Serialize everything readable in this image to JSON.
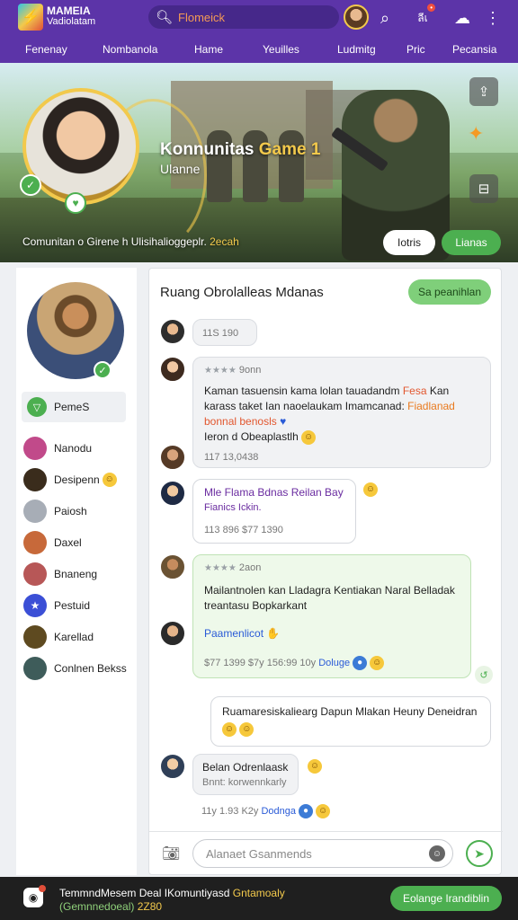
{
  "app": {
    "brand_line1": "MAMEIA",
    "brand_line2": "Vadiolatam",
    "search_text": "Flomeick",
    "notification_text": "ลีเ"
  },
  "nav": [
    "Fenenay",
    "Nombanola",
    "Hame",
    "Yeuilles",
    "Ludmitg",
    "Pric",
    "Pecansia"
  ],
  "hero": {
    "title_main": "Konnunitas",
    "title_highlight": "Game 1",
    "subtitle": "Ulanne",
    "desc_main": "Comunitan o Girene h Ulisihalioggeplr.",
    "desc_highlight": "2ecah",
    "btn_white": "Iotris",
    "btn_green": "Lianas"
  },
  "sidebar": {
    "active_label": "PemeS",
    "items": [
      {
        "label": "Nanodu",
        "color": "#c14a8a"
      },
      {
        "label": "Desipenn",
        "color": "#3a2c1c",
        "emoji": true
      },
      {
        "label": "Paiosh",
        "color": "#a7adb6"
      },
      {
        "label": "Daxel",
        "color": "#c7693a"
      },
      {
        "label": "Bnaneng",
        "color": "#b75757"
      },
      {
        "label": "Pestuid",
        "color": "#3b4fd6"
      },
      {
        "label": "Karellad",
        "color": "#5e4a20"
      },
      {
        "label": "Conlnen Bekss",
        "color": "#3e5c5a"
      }
    ]
  },
  "chat": {
    "title": "Ruang Obrolalleas Mdanas",
    "pill": "Sa peanihlan",
    "msg1": {
      "meta": "11S 190"
    },
    "msg2": {
      "stars": "★★★★",
      "head": "9onn",
      "line1a": "Kaman tasuensin kama lolan tauadandm",
      "line1b": "Fesa",
      "line1c": "Kan",
      "line2a": "karass taket Ian naoelaukam Imamcanad:",
      "line2b": "Fiadlanad",
      "line3": "bonnal benosls",
      "line4": "Ieron d Obeaplastlh",
      "meta": "117 13,0438"
    },
    "msg3": {
      "title": "Mle Flama Bdnas Reilan Bay",
      "sub": "Fianics Ickin.",
      "meta": "113  896    $77 1390"
    },
    "msg4": {
      "stars": "★★★★",
      "head": "2aon",
      "line1": "Mailantnolen kan Lladagra Kentiakan Naral Belladak",
      "line2": "treantasu Bopkarkant",
      "link": "Paamenlicot",
      "meta": "$77 1399   $7y   156:99    10y",
      "tag": "Doluge"
    },
    "msg5": {
      "line": "Ruamaresiskaliearg Dapun Mlakan Heuny Deneidran"
    },
    "msg6": {
      "title": "Belan Odrenlaask",
      "sub": "Bnnt: korwennkarly",
      "meta": "11y  1.93    K2y",
      "tag": "Dodnga"
    },
    "input_placeholder": "Alanaet Gsanmends"
  },
  "bottombar": {
    "line1a": "TemmndMesem Deal IKomuntiyasd",
    "line1b": "Gntamoaly",
    "line2a": "(Gemnnedoeal)",
    "line2b": "2Z80",
    "btn": "Eolange Irandiblin"
  }
}
